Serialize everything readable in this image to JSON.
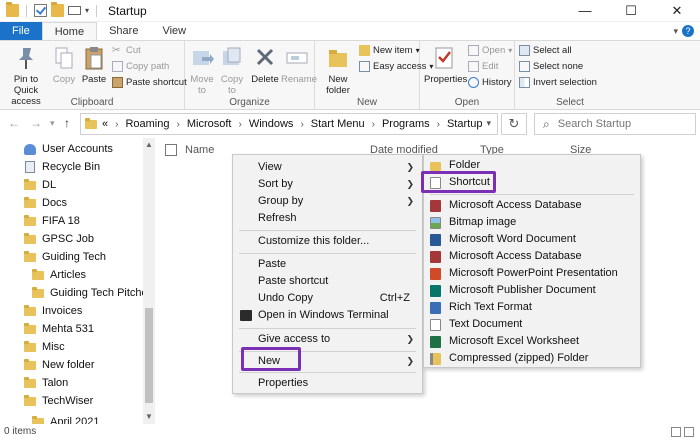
{
  "window": {
    "title": "Startup",
    "minimize": "—",
    "maximize": "☐",
    "close": "✕"
  },
  "ribbon_tabs": [
    "File",
    "Home",
    "Share",
    "View"
  ],
  "ribbon": {
    "clipboard": {
      "label": "Clipboard",
      "pin": "Pin to Quick access",
      "copy": "Copy",
      "paste": "Paste",
      "cut": "Cut",
      "copy_path": "Copy path",
      "paste_shortcut": "Paste shortcut"
    },
    "organize": {
      "label": "Organize",
      "move_to": "Move to",
      "copy_to": "Copy to",
      "delete": "Delete",
      "rename": "Rename"
    },
    "new": {
      "label": "New",
      "new_folder": "New folder",
      "new_item": "New item",
      "easy_access": "Easy access"
    },
    "open": {
      "label": "Open",
      "properties": "Properties",
      "open": "Open",
      "edit": "Edit",
      "history": "History"
    },
    "select": {
      "label": "Select",
      "select_all": "Select all",
      "select_none": "Select none",
      "invert": "Invert selection"
    }
  },
  "address": {
    "prefix": "«",
    "crumbs": [
      "Roaming",
      "Microsoft",
      "Windows",
      "Start Menu",
      "Programs",
      "Startup"
    ],
    "search_placeholder": "Search Startup"
  },
  "nav_items": [
    {
      "label": "User Accounts",
      "kind": "user"
    },
    {
      "label": "Recycle Bin",
      "kind": "bin"
    },
    {
      "label": "DL",
      "kind": "folder"
    },
    {
      "label": "Docs",
      "kind": "folder"
    },
    {
      "label": "FIFA 18",
      "kind": "folder"
    },
    {
      "label": "GPSC Job",
      "kind": "folder"
    },
    {
      "label": "Guiding Tech",
      "kind": "folder"
    },
    {
      "label": "Articles",
      "kind": "folder"
    },
    {
      "label": "Guiding Tech Pitches",
      "kind": "folder"
    },
    {
      "label": "Invoices",
      "kind": "folder"
    },
    {
      "label": "Mehta 531",
      "kind": "folder"
    },
    {
      "label": "Misc",
      "kind": "folder"
    },
    {
      "label": "New folder",
      "kind": "folder"
    },
    {
      "label": "Talon",
      "kind": "folder"
    },
    {
      "label": "TechWiser",
      "kind": "folder"
    },
    {
      "label": "April 2021",
      "kind": "folder"
    }
  ],
  "columns": [
    "Name",
    "Date modified",
    "Type",
    "Size"
  ],
  "status": "0 items",
  "context_menu": {
    "items": [
      "View",
      "Sort by",
      "Group by",
      "Refresh",
      "Customize this folder...",
      "Paste",
      "Paste shortcut",
      "Undo Copy",
      "Open in Windows Terminal",
      "Give access to",
      "New",
      "Properties"
    ],
    "undo_shortcut": "Ctrl+Z"
  },
  "new_submenu": {
    "items": [
      "Folder",
      "Shortcut",
      "Microsoft Access Database",
      "Bitmap image",
      "Microsoft Word Document",
      "Microsoft Access Database",
      "Microsoft PowerPoint Presentation",
      "Microsoft Publisher Document",
      "Rich Text Format",
      "Text Document",
      "Microsoft Excel Worksheet",
      "Compressed (zipped) Folder"
    ]
  },
  "colors": {
    "accent": "#1a73c8",
    "highlight": "#7b2fb5",
    "folder": "#e8c25a"
  }
}
